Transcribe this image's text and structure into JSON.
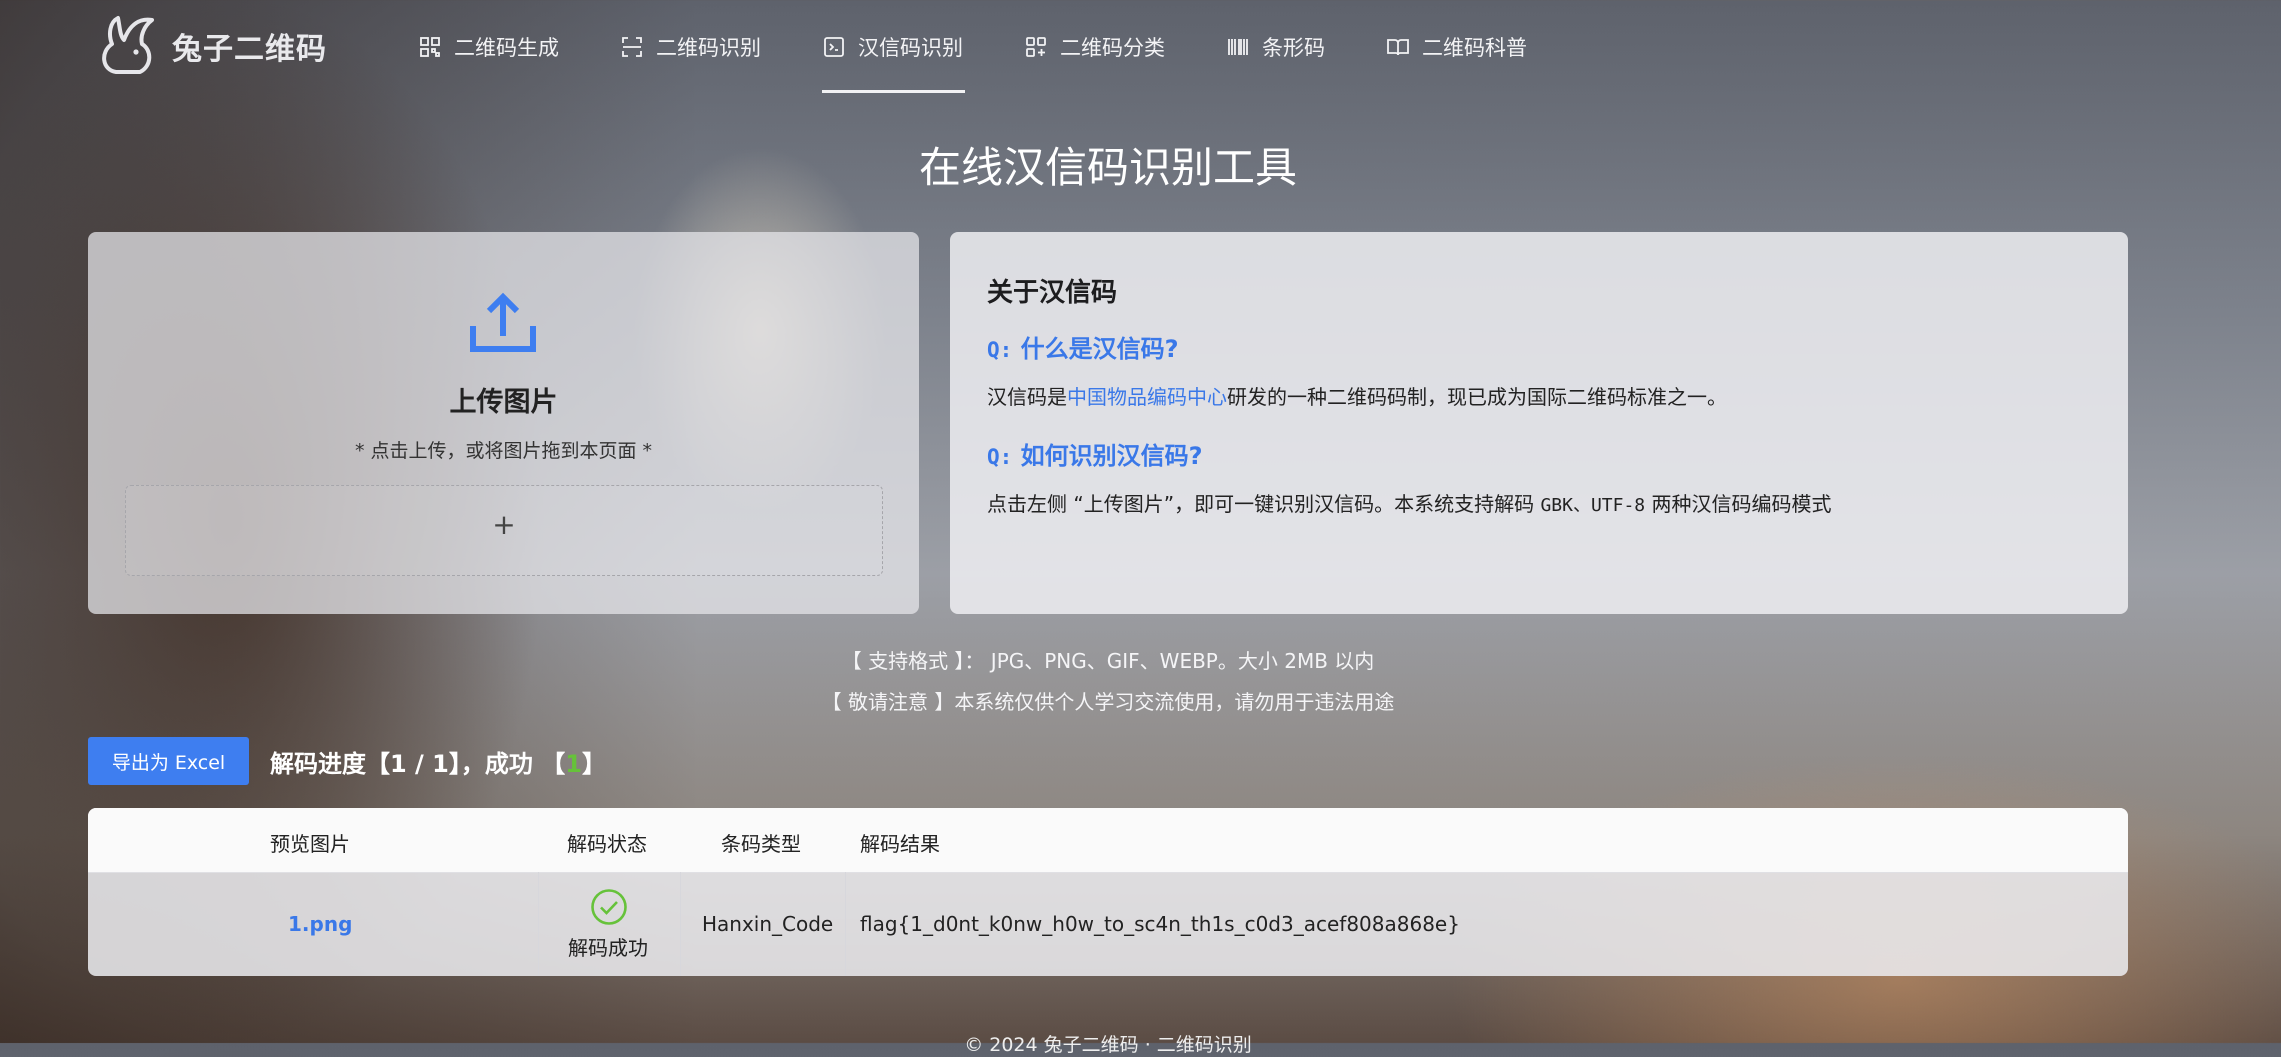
{
  "brand": {
    "name": "兔子二维码",
    "icon": "rabbit-logo"
  },
  "nav": [
    {
      "label": "二维码生成",
      "icon": "qr-grid-icon"
    },
    {
      "label": "二维码识别",
      "icon": "scan-icon"
    },
    {
      "label": "汉信码识别",
      "icon": "terminal-icon",
      "active": true
    },
    {
      "label": "二维码分类",
      "icon": "category-icon"
    },
    {
      "label": "条形码",
      "icon": "barcode-icon"
    },
    {
      "label": "二维码科普",
      "icon": "book-icon"
    }
  ],
  "page_title": "在线汉信码识别工具",
  "upload": {
    "title": "上传图片",
    "hint": "* 点击上传，或将图片拖到本页面 *",
    "plus": "+"
  },
  "about": {
    "title": "关于汉信码",
    "q_mark": "Q:",
    "q1": "什么是汉信码?",
    "a1_prefix": "汉信码是",
    "a1_link": "中国物品编码中心",
    "a1_suffix": "研发的一种二维码码制，现已成为国际二维码标准之一。",
    "q2": "如何识别汉信码?",
    "a2_prefix": "点击左侧 “上传图片”，即可一键识别汉信码。本系统支持解码 ",
    "a2_mono": "GBK、UTF-8",
    "a2_suffix": " 两种汉信码编码模式"
  },
  "notices": {
    "formats": "【 支持格式 】： JPG、PNG、GIF、WEBP。大小 2MB 以内",
    "warning": "【 敬请注意 】本系统仅供个人学习交流使用，请勿用于违法用途"
  },
  "export_button": "导出为 Excel",
  "progress": {
    "prefix": "解码进度【1 / 1】，成功 【",
    "success": "1",
    "suffix": "】"
  },
  "colors": {
    "accent": "#3e7ef0",
    "success": "#66c23a",
    "link": "#3a78e8"
  },
  "table": {
    "headers": [
      "预览图片",
      "解码状态",
      "条码类型",
      "解码结果"
    ],
    "rows": [
      {
        "file": "1.png",
        "status": "解码成功",
        "status_icon": "check-circle-icon",
        "type": "Hanxin_Code",
        "result": "flag{1_d0nt_k0nw_h0w_to_sc4n_th1s_c0d3_acef808a868e}"
      }
    ]
  },
  "footer": "© 2024 兔子二维码 · 二维码识别"
}
